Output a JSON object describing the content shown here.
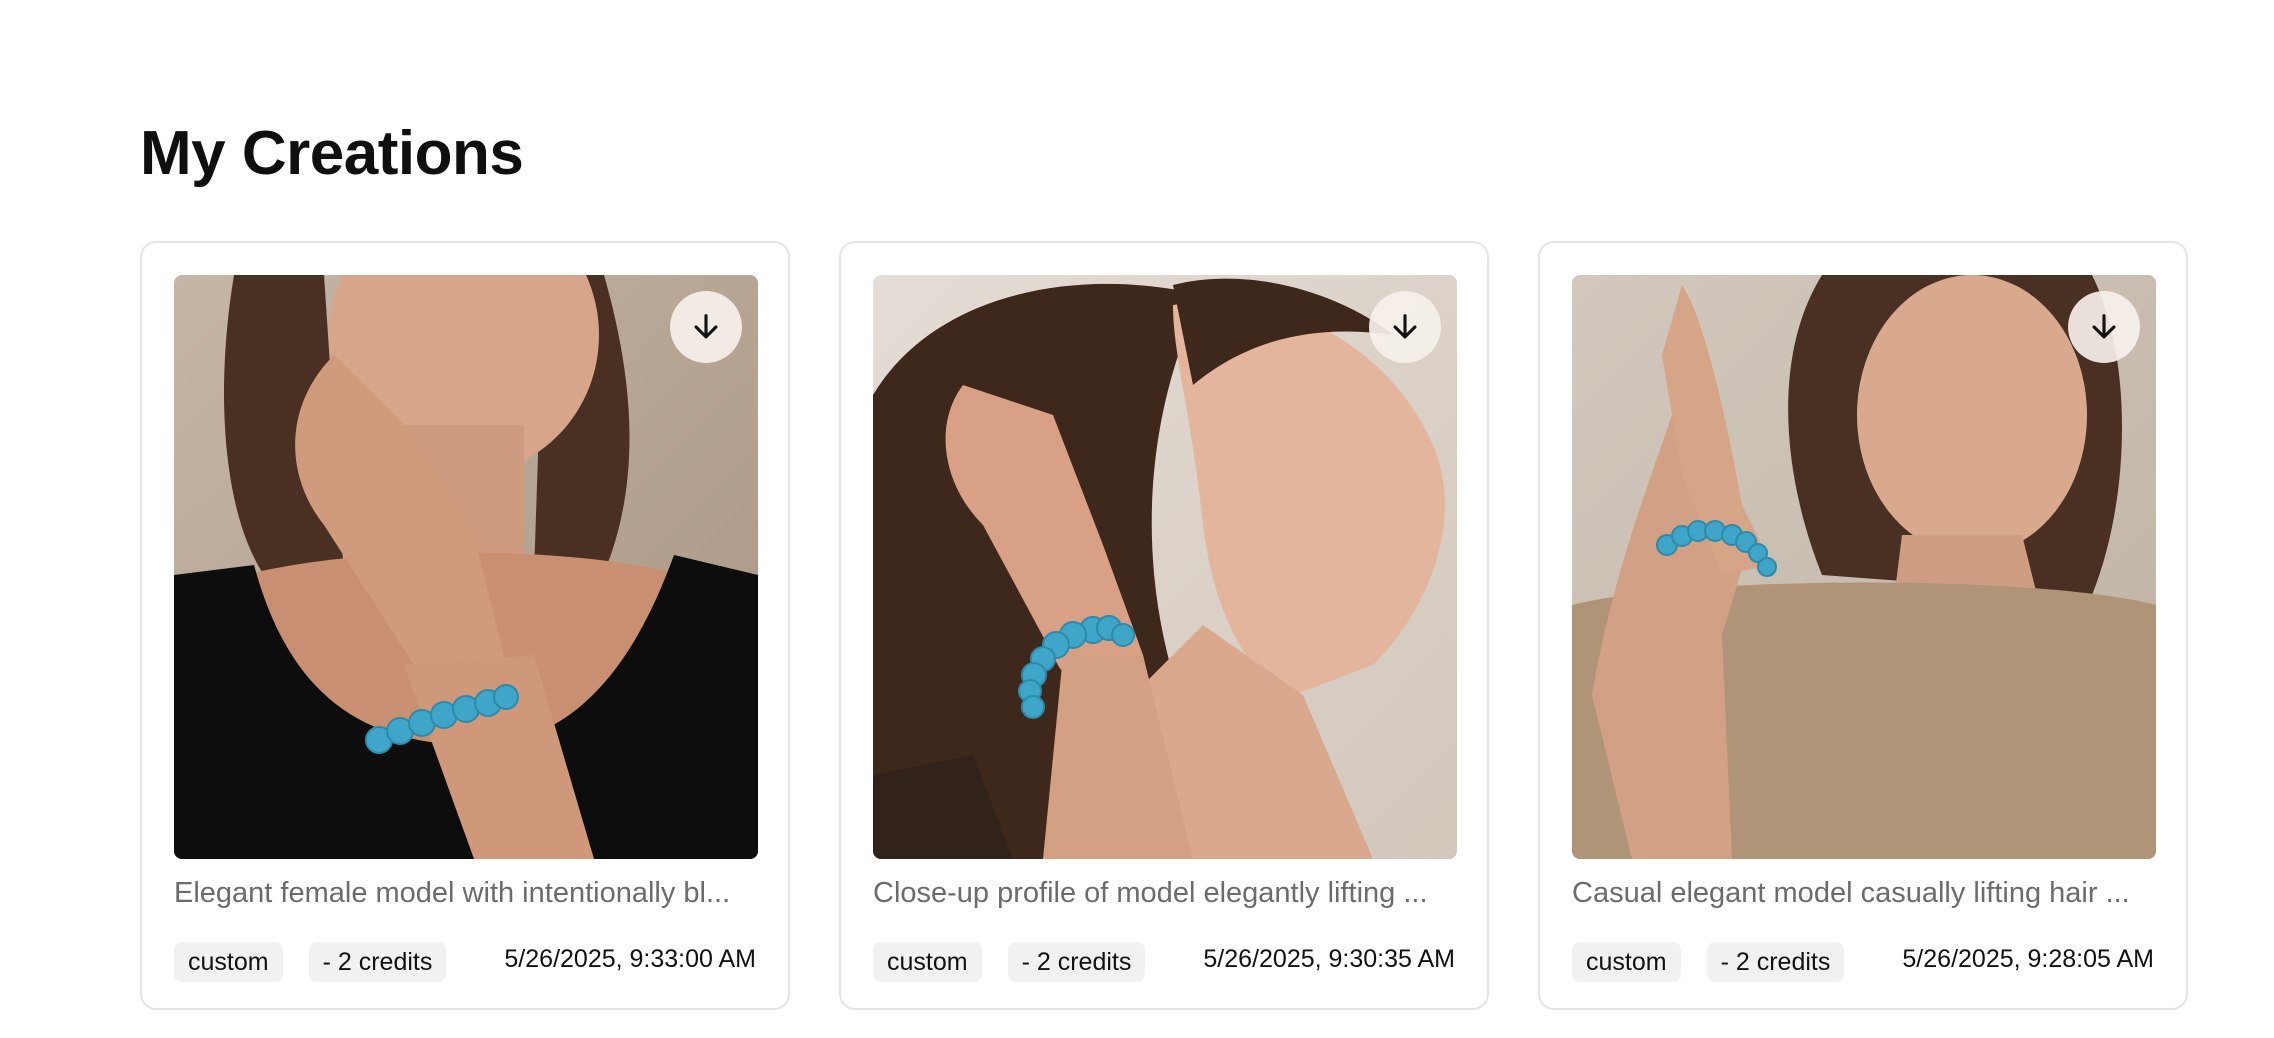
{
  "page": {
    "title": "My Creations"
  },
  "creations": [
    {
      "caption": "Elegant female model with intentionally bl...",
      "style_tag": "custom",
      "credits_tag": "- 2 credits",
      "timestamp": "5/26/2025, 9:33:00 AM",
      "image": "model-black-tank-turquoise-bracelet",
      "download_icon": "arrow-down-icon"
    },
    {
      "caption": "Close-up profile of model elegantly lifting ...",
      "style_tag": "custom",
      "credits_tag": "- 2 credits",
      "timestamp": "5/26/2025, 9:30:35 AM",
      "image": "model-profile-turquoise-bracelet",
      "download_icon": "arrow-down-icon"
    },
    {
      "caption": "Casual elegant model casually lifting hair ...",
      "style_tag": "custom",
      "credits_tag": "- 2 credits",
      "timestamp": "5/26/2025, 9:28:05 AM",
      "image": "model-beige-tee-turquoise-bracelet",
      "download_icon": "arrow-down-icon"
    }
  ],
  "colors": {
    "card_border": "#e5e5e5",
    "tag_bg": "#f1f1f1",
    "caption_text": "#6b6b6b",
    "turquoise": "#3fa6c9"
  }
}
